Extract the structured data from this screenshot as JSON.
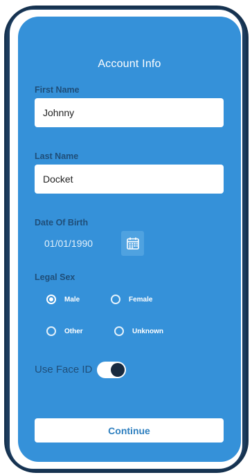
{
  "form": {
    "title": "Account Info",
    "first_name": {
      "label": "First Name",
      "value": "Johnny"
    },
    "last_name": {
      "label": "Last Name",
      "value": "Docket"
    },
    "date_of_birth": {
      "label": "Date Of Birth",
      "value": "01/01/1990",
      "icon": "calendar-icon"
    },
    "legal_sex": {
      "label": "Legal Sex",
      "options": [
        "Male",
        "Female",
        "Other",
        "Unknown"
      ],
      "selected": "Male"
    },
    "face_id": {
      "label": "Use Face ID",
      "enabled": true
    },
    "continue_label": "Continue"
  },
  "colors": {
    "screen_bg": "#3591d9",
    "frame": "#16324f",
    "label_text": "#1f4e79",
    "button_text": "#2e7fbf",
    "toggle_knob": "#182a3f"
  }
}
